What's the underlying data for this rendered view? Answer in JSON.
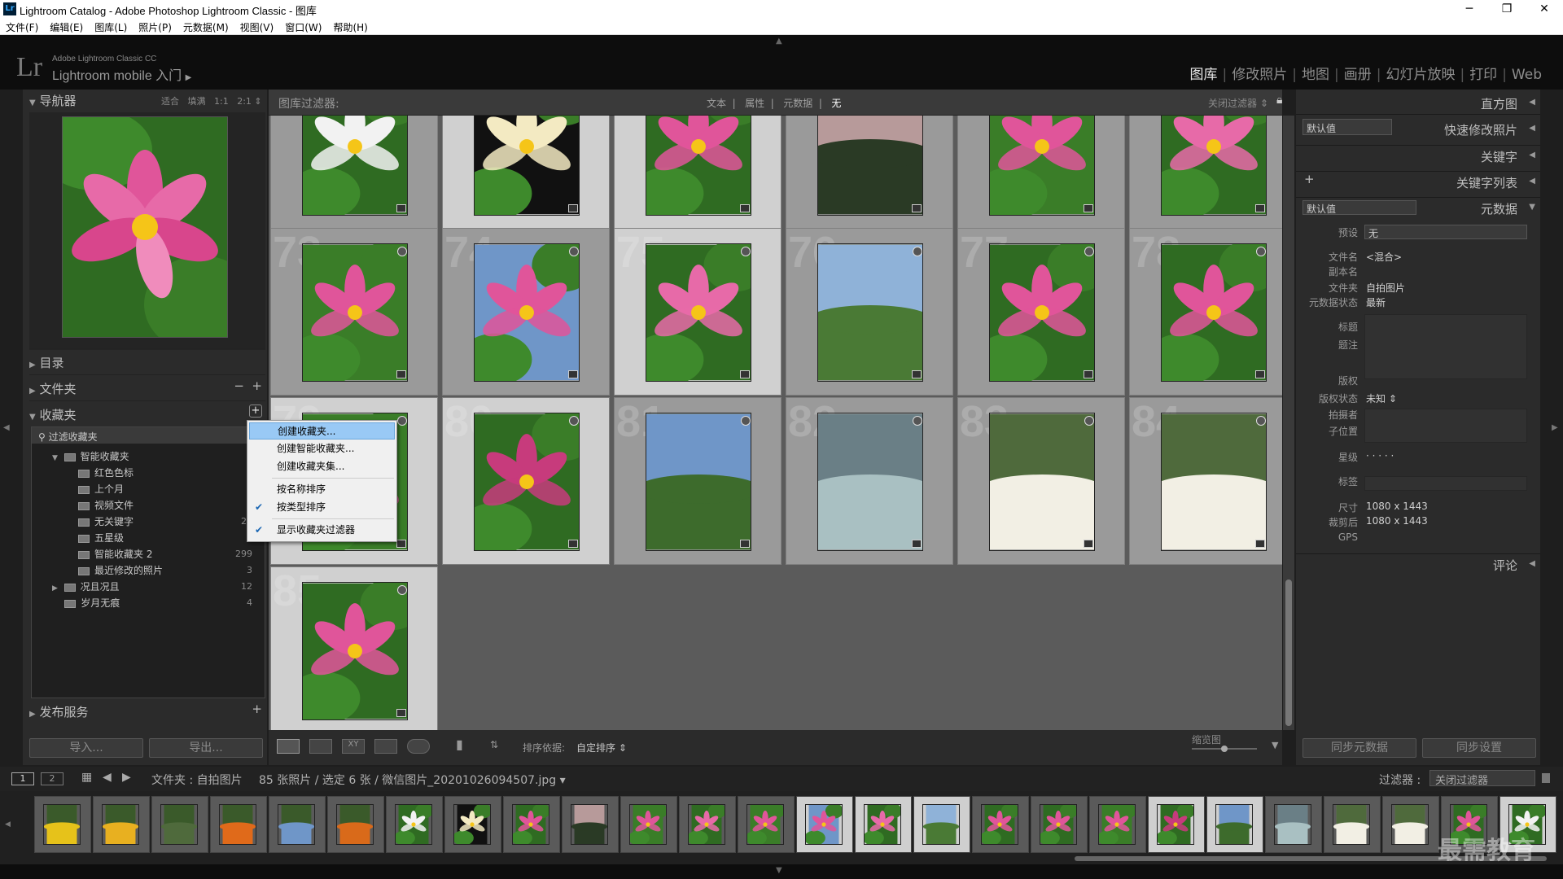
{
  "titlebar": {
    "title": "Lightroom Catalog - Adobe Photoshop Lightroom Classic - 图库",
    "logo": "Lr",
    "min": "─",
    "max": "❐",
    "close": "✕"
  },
  "menu": [
    "文件(F)",
    "编辑(E)",
    "图库(L)",
    "照片(P)",
    "元数据(M)",
    "视图(V)",
    "窗口(W)",
    "帮助(H)"
  ],
  "identity": {
    "mark": "Lr",
    "small": "Adobe Lightroom Classic CC",
    "big": "Lightroom mobile 入门"
  },
  "modules": [
    {
      "label": "图库",
      "active": true
    },
    {
      "label": "修改照片"
    },
    {
      "label": "地图"
    },
    {
      "label": "画册"
    },
    {
      "label": "幻灯片放映"
    },
    {
      "label": "打印"
    },
    {
      "label": "Web"
    }
  ],
  "navigator": {
    "title": "导航器",
    "zoom": [
      "适合",
      "填满",
      "1:1",
      "2:1"
    ]
  },
  "left": {
    "catalog": "目录",
    "folders": "文件夹",
    "collections": "收藏夹",
    "filter_collections": "过滤收藏夹",
    "publish": "发布服务",
    "import": "导入...",
    "export": "导出..."
  },
  "collections": [
    {
      "label": "智能收藏夹",
      "count": "",
      "indent": 1,
      "expand": "▼"
    },
    {
      "label": "红色色标",
      "count": "",
      "indent": 2
    },
    {
      "label": "上个月",
      "count": "2",
      "indent": 2
    },
    {
      "label": "视频文件",
      "count": "",
      "indent": 2
    },
    {
      "label": "无关键字",
      "count": "29",
      "indent": 2
    },
    {
      "label": "五星级",
      "count": "",
      "indent": 2
    },
    {
      "label": "智能收藏夹 2",
      "count": "299",
      "indent": 2
    },
    {
      "label": "最近修改的照片",
      "count": "3",
      "indent": 2
    },
    {
      "label": "况且况且",
      "count": "12",
      "indent": 1,
      "expand": "▶"
    },
    {
      "label": "岁月无痕",
      "count": "4",
      "indent": 1
    }
  ],
  "context_menu": [
    {
      "label": "创建收藏夹...",
      "highlight": true
    },
    {
      "label": "创建智能收藏夹..."
    },
    {
      "label": "创建收藏夹集..."
    },
    {
      "label": "按名称排序"
    },
    {
      "label": "按类型排序",
      "checked": true
    },
    {
      "label": "显示收藏夹过滤器",
      "checked": true
    }
  ],
  "filterbar": {
    "title": "图库过滤器:",
    "tabs": [
      "文本",
      "属性",
      "元数据",
      "无"
    ],
    "right": "关闭过滤器 ⇕"
  },
  "grid_numbers": [
    "73",
    "74",
    "75",
    "76",
    "77",
    "78",
    "79",
    "80",
    "81",
    "82",
    "83",
    "84",
    "85"
  ],
  "toolbar": {
    "sort_label": "排序依据:",
    "sort_value": "自定排序 ⇕",
    "thumb_label": "缩览图"
  },
  "right": {
    "histogram": "直方图",
    "quick_develop": "快速修改照片",
    "default1": "默认值",
    "keywording": "关键字",
    "keyword_list": "关键字列表",
    "default2": "默认值",
    "metadata": "元数据",
    "preset_label": "预设",
    "preset_value": "无",
    "comments": "评论",
    "sync_meta": "同步元数据",
    "sync_settings": "同步设置"
  },
  "metadata_rows": [
    {
      "label": "文件名",
      "value": "<混合>"
    },
    {
      "label": "副本名",
      "value": ""
    },
    {
      "label": "文件夹",
      "value": "自拍图片"
    },
    {
      "label": "元数据状态",
      "value": "最新"
    },
    {
      "label": "标题",
      "value": ""
    },
    {
      "label": "题注",
      "value": ""
    },
    {
      "label": "版权",
      "value": ""
    },
    {
      "label": "版权状态",
      "value": "未知 ⇕"
    },
    {
      "label": "拍摄者",
      "value": ""
    },
    {
      "label": "子位置",
      "value": ""
    },
    {
      "label": "星级",
      "value": "· · · · ·"
    },
    {
      "label": "标签",
      "value": ""
    },
    {
      "label": "尺寸",
      "value": "1080 x 1443"
    },
    {
      "label": "裁剪后",
      "value": "1080 x 1443"
    },
    {
      "label": "GPS",
      "value": ""
    }
  ],
  "bottom": {
    "view1": "1",
    "view2": "2",
    "path": "文件夹 : 自拍图片",
    "count": "85 张照片 / 选定 6 张 / 微信图片_20201026094507.jpg ▾",
    "filter_label": "过滤器 :",
    "filter_value": "关闭过滤器"
  },
  "watermark": "最需教育",
  "colors": {
    "accent": "#99c9f5",
    "lotus": "#e0559a",
    "leaf": "#2f6b22",
    "sky": "#6f96c8"
  }
}
